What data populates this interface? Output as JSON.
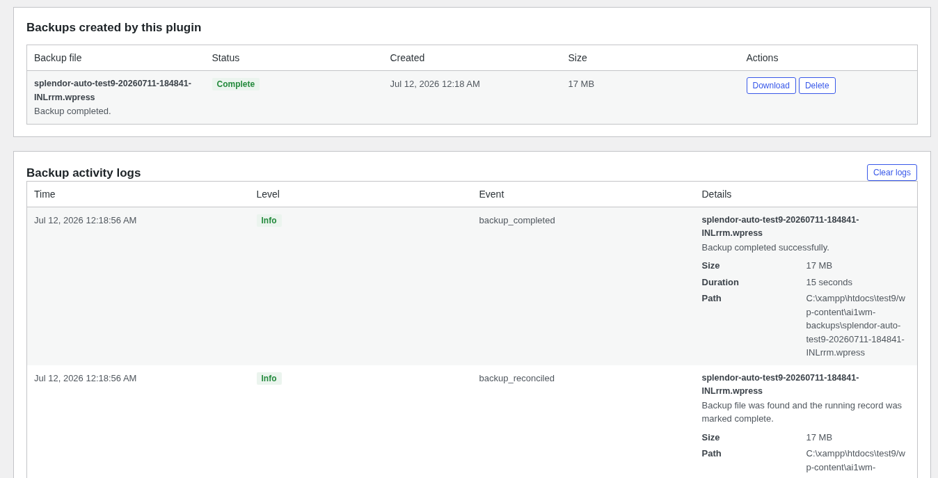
{
  "backups_panel": {
    "title": "Backups created by this plugin",
    "table": {
      "columns": [
        "Backup file",
        "Status",
        "Created",
        "Size",
        "Actions"
      ],
      "rows": [
        {
          "file": "splendor-auto-test9-20260711-184841-INLrrm.wpress",
          "note": "Backup completed.",
          "status": {
            "label": "Complete",
            "color": "#248a3d"
          },
          "created": "Jul 12, 2026 12:18 AM",
          "size": "17 MB",
          "actions": [
            "Download",
            "Delete"
          ]
        }
      ]
    }
  },
  "logs_panel": {
    "title": "Backup activity logs",
    "clear_button": "Clear logs",
    "table": {
      "columns": [
        "Time",
        "Level",
        "Event",
        "Details"
      ],
      "rows": [
        {
          "time": "Jul 12, 2026 12:18:56 AM",
          "level": {
            "label": "Info",
            "color": "#248a3d"
          },
          "event": "backup_completed",
          "details": {
            "file": "splendor-auto-test9-20260711-184841-INLrrm.wpress",
            "message": "Backup completed successfully.",
            "meta": [
              {
                "label": "Size",
                "value": "17 MB"
              },
              {
                "label": "Duration",
                "value": "15 seconds"
              },
              {
                "label": "Path",
                "value": "C:\\xampp\\htdocs\\test9/wp-content\\ai1wm-backups\\splendor-auto-test9-20260711-184841-INLrrm.wpress"
              }
            ]
          }
        },
        {
          "time": "Jul 12, 2026 12:18:56 AM",
          "level": {
            "label": "Info",
            "color": "#248a3d"
          },
          "event": "backup_reconciled",
          "details": {
            "file": "splendor-auto-test9-20260711-184841-INLrrm.wpress",
            "message": "Backup file was found and the running record was marked complete.",
            "meta": [
              {
                "label": "Size",
                "value": "17 MB"
              },
              {
                "label": "Path",
                "value": "C:\\xampp\\htdocs\\test9/wp-content\\ai1wm-"
              }
            ]
          }
        }
      ]
    }
  }
}
